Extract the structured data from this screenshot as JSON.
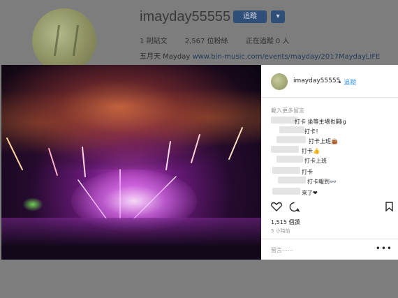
{
  "profile": {
    "username": "imayday55555",
    "follow_label": "追蹤",
    "more_label": "▾",
    "stats": [
      "1 則貼文",
      "2,567 位粉絲",
      "正在追蹤 0 人"
    ],
    "bio_name": "五月天 Mayday",
    "bio_link": "www.bin-music.com/events/mayday/2017MaydayLIFE"
  },
  "post": {
    "username": "imayday55555",
    "separator": "•",
    "follow_label": "追蹤",
    "load_more": "載入更多留言",
    "comments": [
      "打卡 坐等主場也開ig",
      "打卡！",
      "打卡上班👜",
      "打卡👍",
      "打卡上班",
      "打卡",
      "打卡報到👓",
      "來了❤"
    ],
    "likes": "1,515 個讚",
    "time": "5 小時前",
    "comment_placeholder": "留言⋯⋯",
    "more_icon": "•••"
  }
}
